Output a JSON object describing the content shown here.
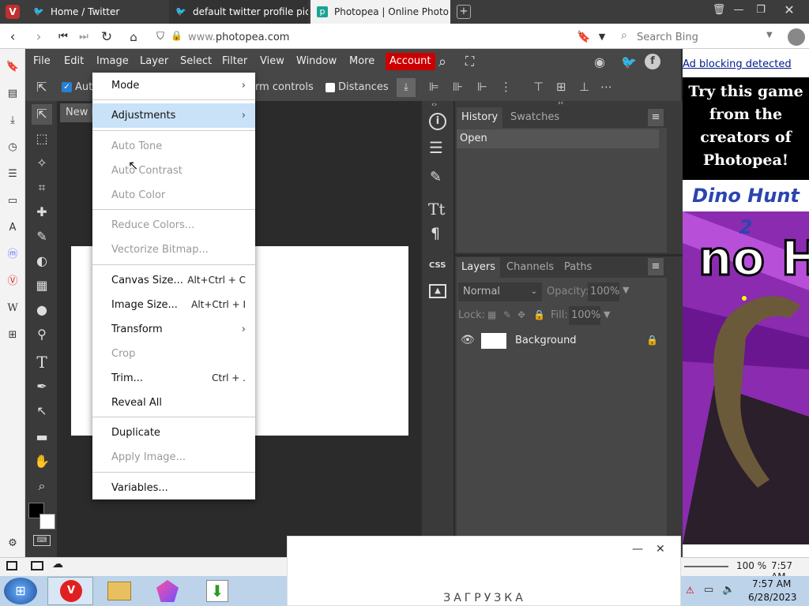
{
  "browser": {
    "tabs": [
      {
        "title": "Home / Twitter",
        "icon": "twitter-bird-icon"
      },
      {
        "title": "default twitter profile pictur",
        "icon": "twitter-bird-icon"
      },
      {
        "title": "Photopea | Online Photo Ec",
        "icon": "photopea-icon"
      }
    ],
    "url_prefix": "www.",
    "url_domain": "photopea.com",
    "search_placeholder": "Search Bing"
  },
  "photopea": {
    "menu": [
      "File",
      "Edit",
      "Image",
      "Layer",
      "Select",
      "Filter",
      "View",
      "Window",
      "More"
    ],
    "account_label": "Account",
    "account_color": "#cc0000",
    "options": {
      "auto_select": "Aut",
      "transform_controls": "rm controls",
      "distances": "Distances"
    },
    "doc_tab": "New F",
    "history_tab": "History",
    "swatches_tab": "Swatches",
    "history_item": "Open",
    "layers_tab": "Layers",
    "channels_tab": "Channels",
    "paths_tab": "Paths",
    "blend_mode": "Normal",
    "opacity_label": "Opacity:",
    "opacity_value": "100%",
    "lock_label": "Lock:",
    "fill_label": "Fill:",
    "fill_value": "100%",
    "layer_name": "Background",
    "image_menu": {
      "mode": "Mode",
      "adjustments": "Adjustments",
      "auto_tone": "Auto Tone",
      "auto_contrast": "Auto Contrast",
      "auto_color": "Auto Color",
      "reduce_colors": "Reduce Colors...",
      "vectorize_bitmap": "Vectorize Bitmap...",
      "canvas_size": "Canvas Size...",
      "canvas_size_sc": "Alt+Ctrl + C",
      "image_size": "Image Size...",
      "image_size_sc": "Alt+Ctrl + I",
      "transform": "Transform",
      "crop": "Crop",
      "trim": "Trim...",
      "trim_sc": "Ctrl + .",
      "reveal_all": "Reveal All",
      "duplicate": "Duplicate",
      "apply_image": "Apply Image...",
      "variables": "Variables..."
    }
  },
  "ad": {
    "blocking_text": "Ad blocking detected",
    "promo": "Try this game from the creators of Photopea!",
    "game_title": "Dino Hunt 2"
  },
  "statusbar": {
    "zoom": "100 %",
    "time": "7:57 AM"
  },
  "loader_text": "ЗАГРУЗКА",
  "taskbar": {
    "time": "7:57 AM",
    "date": "6/28/2023"
  }
}
